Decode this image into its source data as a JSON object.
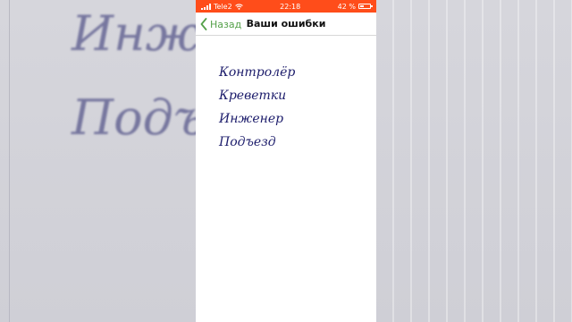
{
  "status_bar": {
    "carrier": "Tele2",
    "time": "22:18",
    "battery_text": "42 %",
    "battery_level": 0.42
  },
  "nav": {
    "back_label": "Назад",
    "title": "Ваши ошибки"
  },
  "words": [
    "Контролёр",
    "Креветки",
    "Инженер",
    "Подъезд"
  ],
  "background_words": [
    "Инжен",
    "Подъе"
  ],
  "colors": {
    "status_bar": "#ff4d1a",
    "back_accent": "#55a14a",
    "word_ink": "#1c1c6b"
  },
  "icons": [
    "signal-icon",
    "wifi-icon",
    "battery-icon",
    "chevron-left-icon"
  ]
}
